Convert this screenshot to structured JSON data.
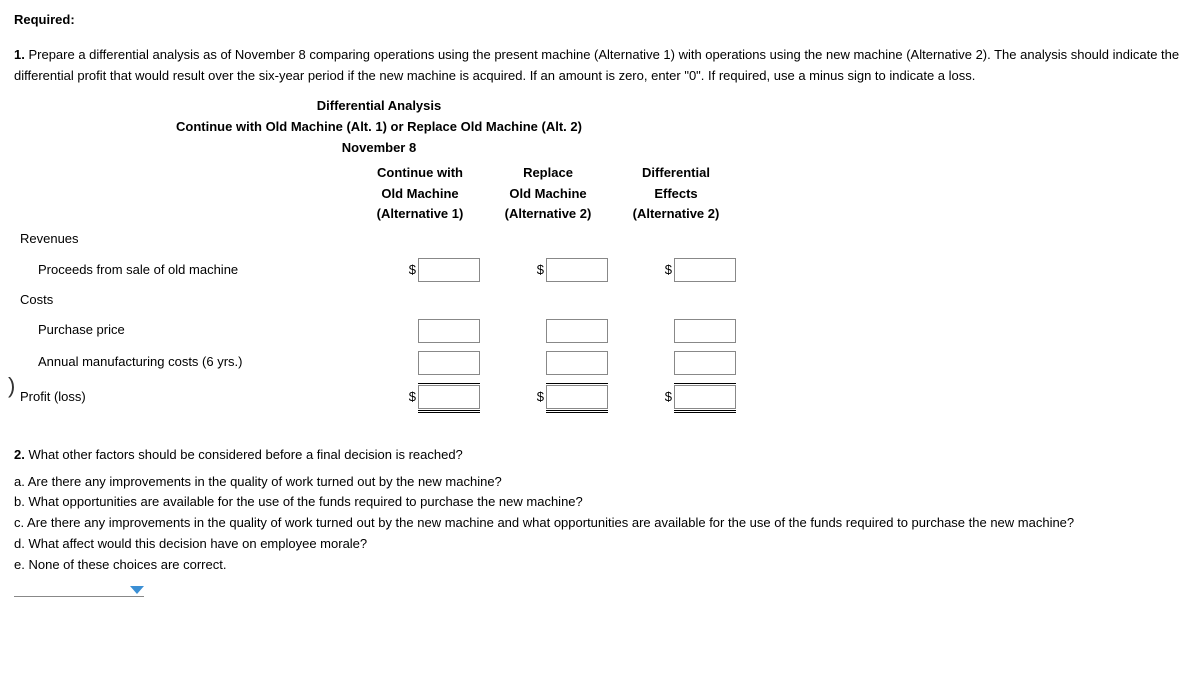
{
  "required_label": "Required:",
  "q1": {
    "num": "1.",
    "text": "Prepare a differential analysis as of November 8 comparing operations using the present machine (Alternative 1) with operations using the new machine (Alternative 2). The analysis should indicate the differential profit that would result over the six-year period if the new machine is acquired. If an amount is zero, enter \"0\". If required, use a minus sign to indicate a loss."
  },
  "analysis": {
    "title": "Differential Analysis",
    "subtitle": "Continue with Old Machine (Alt. 1) or Replace Old Machine (Alt. 2)",
    "date": "November 8",
    "cols": [
      {
        "l1": "Continue with",
        "l2": "Old Machine",
        "l3": "(Alternative 1)"
      },
      {
        "l1": "Replace",
        "l2": "Old Machine",
        "l3": "(Alternative 2)"
      },
      {
        "l1": "Differential",
        "l2": "Effects",
        "l3": "(Alternative 2)"
      }
    ],
    "rows": {
      "revenues": "Revenues",
      "proceeds": "Proceeds from sale of old machine",
      "costs": "Costs",
      "purchase": "Purchase price",
      "annual": "Annual manufacturing costs (6 yrs.)",
      "profit": "Profit (loss)"
    },
    "currency": "$"
  },
  "q2": {
    "num": "2.",
    "question": "What other factors should be considered before a final decision is reached?",
    "options": [
      {
        "letter": "a.",
        "text": "Are there any improvements in the quality of work turned out by the new machine?"
      },
      {
        "letter": "b.",
        "text": "What opportunities are available for the use of the funds required to purchase the new machine?"
      },
      {
        "letter": "c.",
        "text": "Are there any improvements in the quality of work turned out by the new machine and what opportunities are available for the use of the funds required to purchase the new machine?"
      },
      {
        "letter": "d.",
        "text": "What affect would this decision have on employee morale?"
      },
      {
        "letter": "e.",
        "text": "None of these choices are correct."
      }
    ]
  }
}
